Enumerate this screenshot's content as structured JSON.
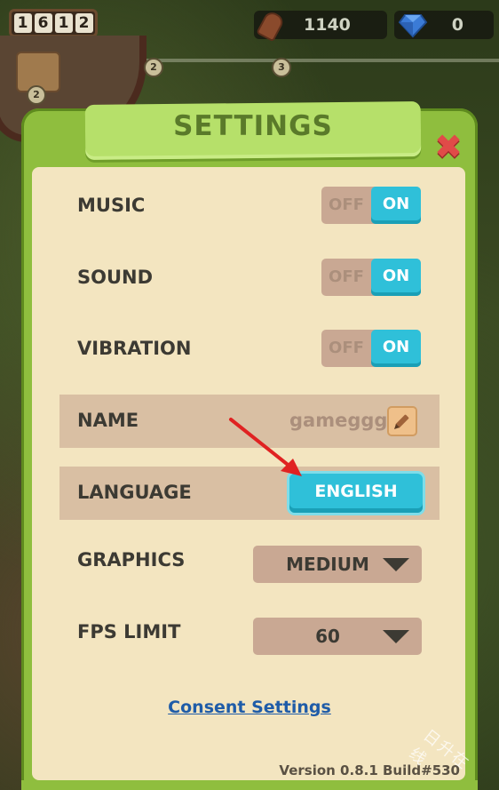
{
  "hud": {
    "clock_digits": [
      "1",
      "6",
      "1",
      "2"
    ],
    "wood": "1140",
    "gems": "0",
    "level_nodes": [
      "2",
      "3"
    ],
    "portrait_level": "2"
  },
  "dialog": {
    "title": "SETTINGS",
    "close_icon": "close-x-icon"
  },
  "settings": {
    "music": {
      "label": "MUSIC",
      "off": "OFF",
      "on": "ON",
      "state": "on"
    },
    "sound": {
      "label": "SOUND",
      "off": "OFF",
      "on": "ON",
      "state": "on"
    },
    "vibration": {
      "label": "VIBRATION",
      "off": "OFF",
      "on": "ON",
      "state": "on"
    },
    "name": {
      "label": "NAME",
      "value": "gameggg"
    },
    "language": {
      "label": "LANGUAGE",
      "value": "ENGLISH"
    },
    "graphics": {
      "label": "GRAPHICS",
      "value": "MEDIUM"
    },
    "fps": {
      "label": "FPS LIMIT",
      "value": "60"
    }
  },
  "footer": {
    "consent": "Consent Settings",
    "version": "Version 0.8.1 Build#530"
  },
  "watermark": "日升在线",
  "colors": {
    "frame_green": "#8fbe3e",
    "panel_cream": "#f3e5c0",
    "toggle_on": "#2fc0d9",
    "close_red": "#e04b48",
    "link_blue": "#1f5ca8",
    "annotation_arrow": "#e02222"
  }
}
